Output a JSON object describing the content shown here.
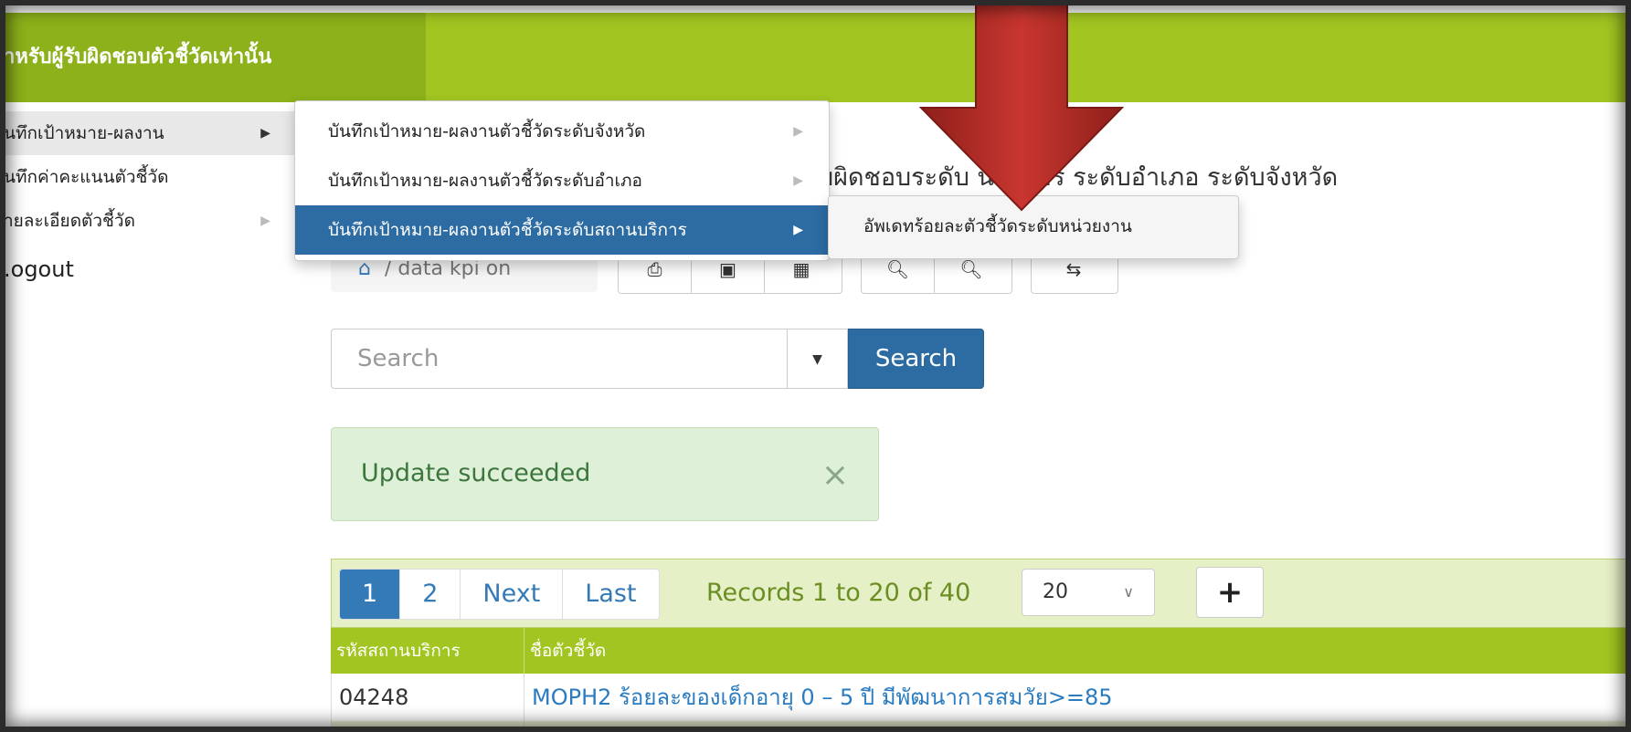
{
  "header": {
    "brand_text": "าหรับผู้รับผิดชอบตัวชี้วัดเท่านั้น",
    "accent": "#a2c521"
  },
  "sidebar": {
    "items": [
      {
        "label": "ันทึกเป้าหมาย-ผลงาน",
        "has_submenu": true,
        "active": true
      },
      {
        "label": "ันทึกค่าคะแนนตัวชี้วัด",
        "has_submenu": false
      },
      {
        "label": "ายละเอียดตัวชี้วัด",
        "has_submenu": true
      },
      {
        "label": ".ogout",
        "has_submenu": false
      }
    ]
  },
  "menu": {
    "items": [
      {
        "label": "บันทึกเป้าหมาย-ผลงานตัวชี้วัดระดับจังหวัด"
      },
      {
        "label": "บันทึกเป้าหมาย-ผลงานตัวชี้วัดระดับอำเภอ"
      },
      {
        "label": "บันทึกเป้าหมาย-ผลงานตัวชี้วัดระดับสถานบริการ",
        "active": true
      }
    ],
    "flyout": {
      "label": "อัพเดทร้อยละตัวชี้วัดระดับหน่วยงาน"
    }
  },
  "page": {
    "heading_fragment": "บผิดชอบระดับ    นบริการ ระดับอำเภอ ระดับจังหวัด"
  },
  "breadcrumb": {
    "home_icon": "home-icon",
    "text": "data kpi on"
  },
  "toolbar": {
    "icons": [
      "print-icon",
      "export-pdf-icon",
      "export-excel-icon",
      "zoom-in-icon",
      "zoom-out-icon",
      "column-chooser-icon"
    ]
  },
  "search": {
    "placeholder": "Search",
    "button_label": "Search",
    "button_color": "#2d6ca2"
  },
  "alert": {
    "message": "Update succeeded",
    "close": "×"
  },
  "grid": {
    "pager": [
      "1",
      "2",
      "Next",
      "Last"
    ],
    "current_page": "1",
    "records_text": "Records 1 to 20 of 40",
    "page_size": "20",
    "add_button": "+",
    "columns": [
      "รหัสสถานบริการ",
      "ชื่อตัวชี้วัด"
    ],
    "rows": [
      {
        "code": "04248",
        "name": "MOPH2 ร้อยละของเด็กอายุ 0 – 5 ปี มีพัฒนาการสมวัย>=85"
      }
    ]
  },
  "annotation": {
    "arrow_color": "#c0302b"
  }
}
